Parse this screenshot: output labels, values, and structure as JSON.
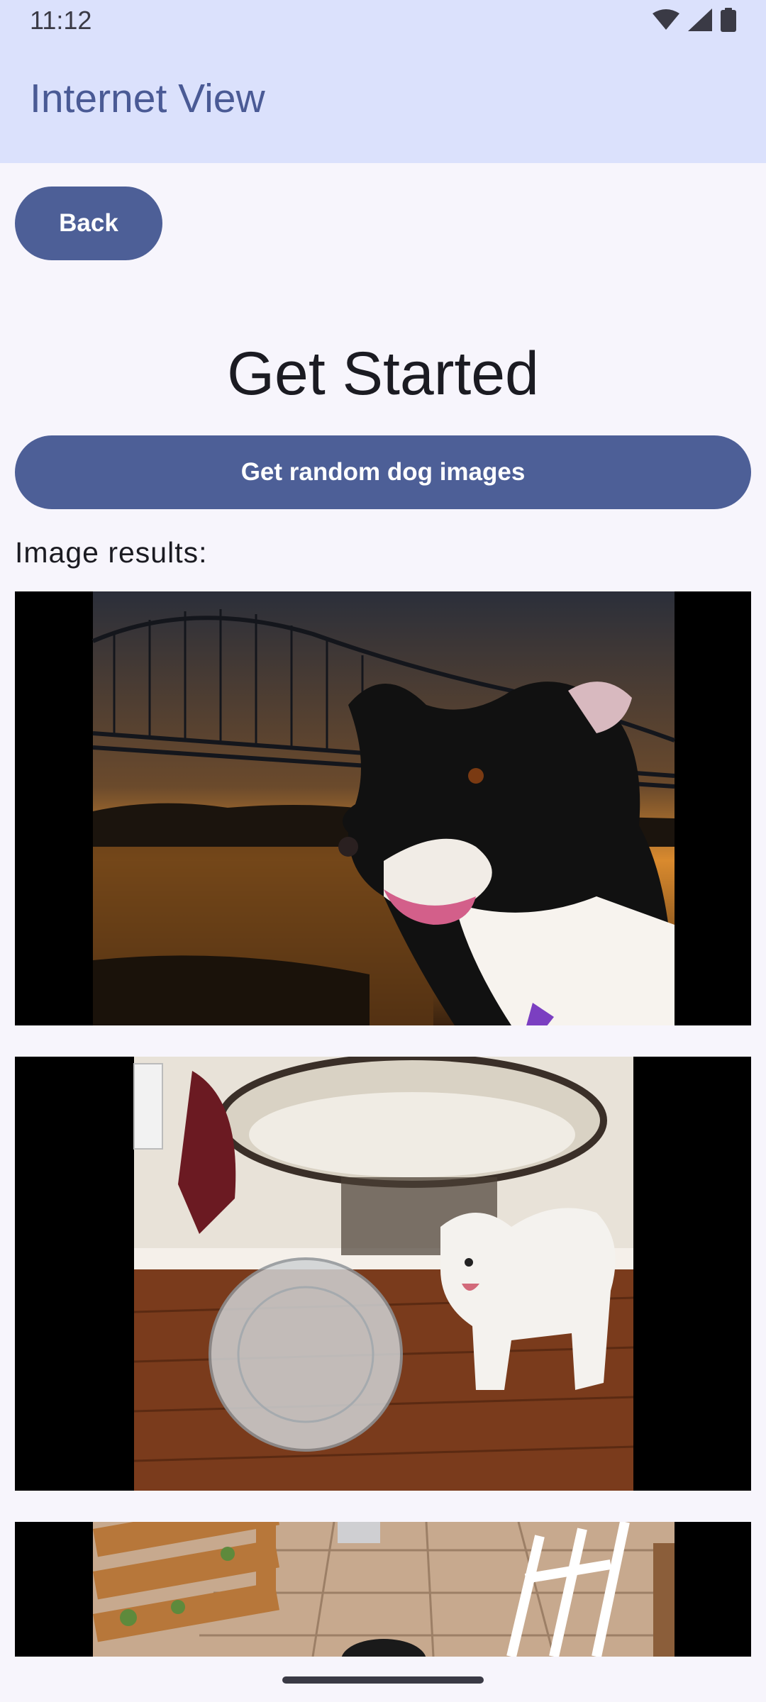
{
  "status_bar": {
    "time": "11:12",
    "icons": [
      "wifi-icon",
      "signal-icon",
      "battery-icon"
    ]
  },
  "app_bar": {
    "title": "Internet View"
  },
  "back_button": {
    "label": "Back"
  },
  "heading": "Get Started",
  "random_button": {
    "label": "Get random dog images"
  },
  "results_label": "Image results:",
  "images": [
    {
      "subject": "dog at sunset by river bridge"
    },
    {
      "subject": "white dog next to clear ball and papasan chair"
    },
    {
      "subject": "dog on tiled patio with wooden railing"
    }
  ],
  "colors": {
    "primary": "#4d5f97",
    "app_bar": "#dbe1fc",
    "background": "#f7f5fc",
    "title_text": "#4a5a95"
  }
}
